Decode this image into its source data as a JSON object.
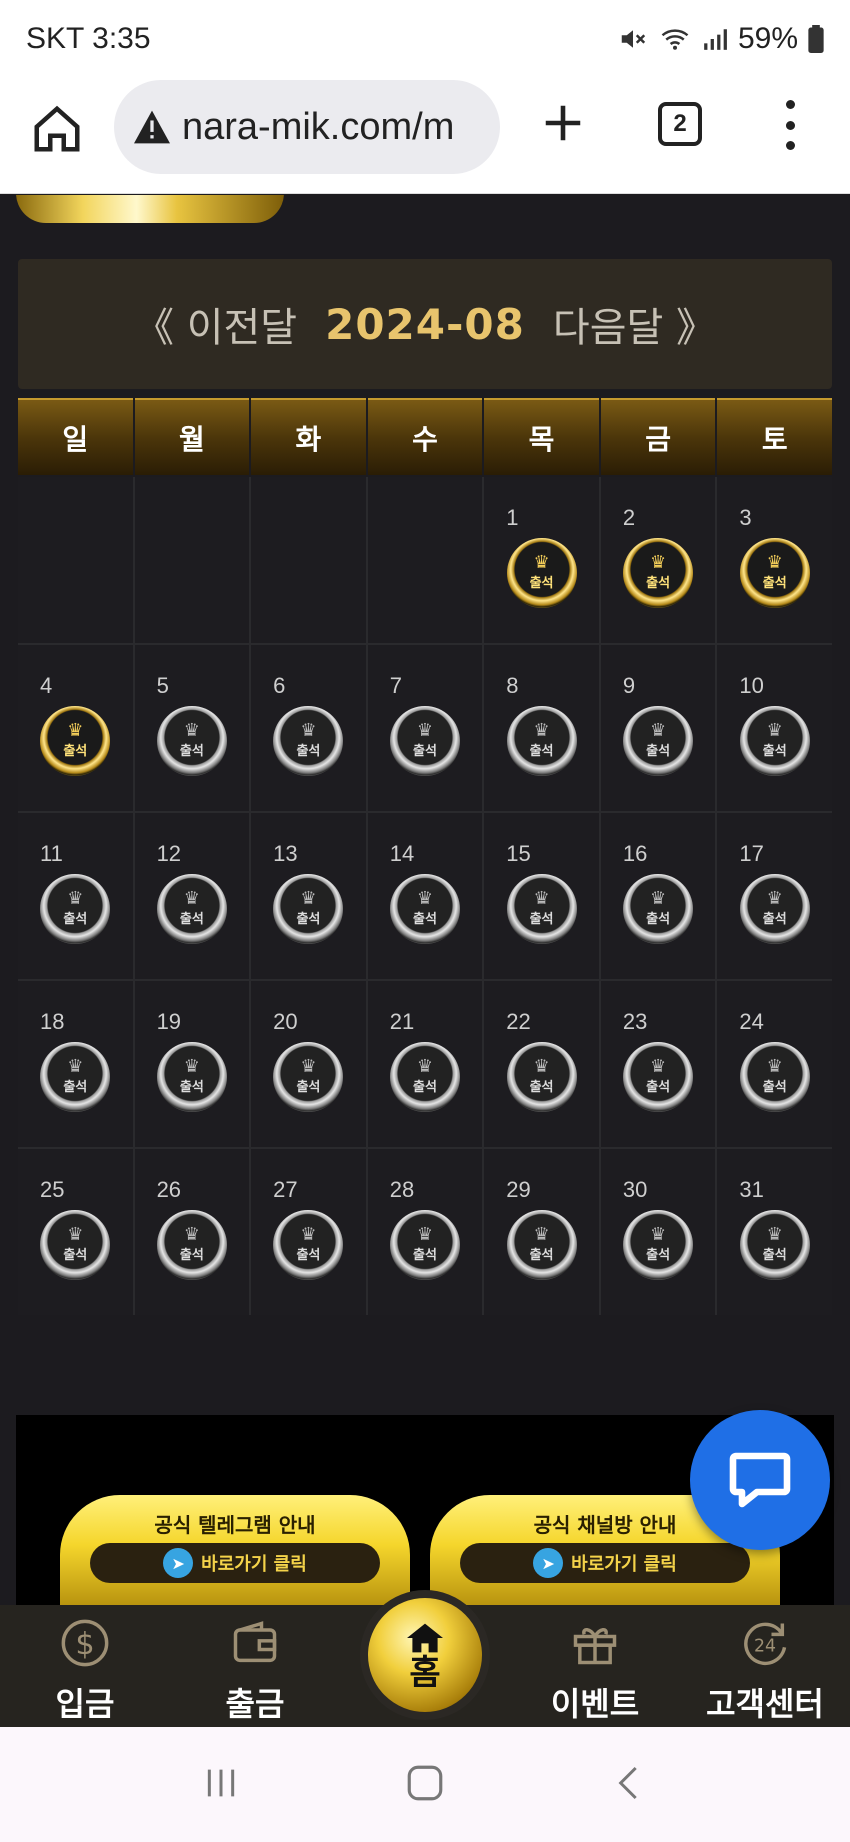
{
  "status_bar": {
    "carrier_time": "SKT 3:35",
    "battery": "59%"
  },
  "browser": {
    "url": "nara-mik.com/m",
    "tab_count": "2"
  },
  "calendar": {
    "prev_label": "《 이전달",
    "current_month": "2024-08",
    "next_label": "다음달 》",
    "weekdays": [
      "일",
      "월",
      "화",
      "수",
      "목",
      "금",
      "토"
    ],
    "leading_blanks": 4,
    "stamp_label": "출석",
    "days": [
      {
        "n": "1",
        "attended": true
      },
      {
        "n": "2",
        "attended": true
      },
      {
        "n": "3",
        "attended": true
      },
      {
        "n": "4",
        "attended": true
      },
      {
        "n": "5",
        "attended": false
      },
      {
        "n": "6",
        "attended": false
      },
      {
        "n": "7",
        "attended": false
      },
      {
        "n": "8",
        "attended": false
      },
      {
        "n": "9",
        "attended": false
      },
      {
        "n": "10",
        "attended": false
      },
      {
        "n": "11",
        "attended": false
      },
      {
        "n": "12",
        "attended": false
      },
      {
        "n": "13",
        "attended": false
      },
      {
        "n": "14",
        "attended": false
      },
      {
        "n": "15",
        "attended": false
      },
      {
        "n": "16",
        "attended": false
      },
      {
        "n": "17",
        "attended": false
      },
      {
        "n": "18",
        "attended": false
      },
      {
        "n": "19",
        "attended": false
      },
      {
        "n": "20",
        "attended": false
      },
      {
        "n": "21",
        "attended": false
      },
      {
        "n": "22",
        "attended": false
      },
      {
        "n": "23",
        "attended": false
      },
      {
        "n": "24",
        "attended": false
      },
      {
        "n": "25",
        "attended": false
      },
      {
        "n": "26",
        "attended": false
      },
      {
        "n": "27",
        "attended": false
      },
      {
        "n": "28",
        "attended": false
      },
      {
        "n": "29",
        "attended": false
      },
      {
        "n": "30",
        "attended": false
      },
      {
        "n": "31",
        "attended": false
      }
    ]
  },
  "banner": {
    "left_title": "공식 텔레그램 안내",
    "left_link": "바로가기 클릭",
    "right_title": "공식 채널방 안내",
    "right_link": "바로가기 클릭"
  },
  "bottom_nav": {
    "deposit": "입금",
    "withdraw": "출금",
    "home": "홈",
    "event": "이벤트",
    "support": "고객센터"
  },
  "colors": {
    "gold": "#e8c46d",
    "chat_blue": "#1f6fe6",
    "page_bg": "#1c1b1f"
  }
}
